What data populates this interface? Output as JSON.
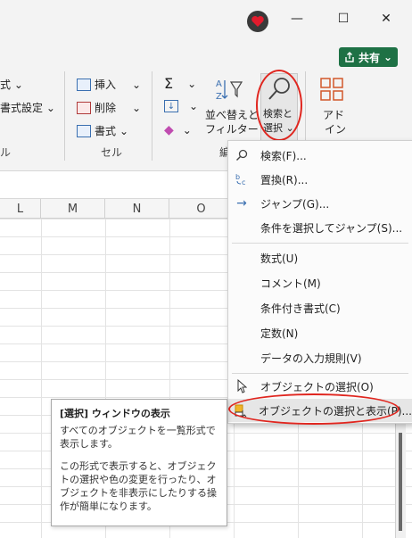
{
  "titlebar": {
    "avatar_icon": "heart-avatar",
    "minimize": "—",
    "maximize": "☐",
    "close": "✕"
  },
  "ribbon": {
    "share": {
      "label": "共有",
      "icon": "share-icon",
      "chevron": "⌄"
    },
    "left_partial": {
      "row1": "式 ⌄",
      "row2": "書式設定 ⌄",
      "group_tail": "ル"
    },
    "cells_group": {
      "insert": "挿入",
      "delete": "削除",
      "format": "書式",
      "label": "セル"
    },
    "editing_group": {
      "sum_icon": "Σ",
      "fill_icon": "↓",
      "clear_icon": "◆",
      "sort_filter": [
        "並べ替えと",
        "フィルター"
      ],
      "find_select": [
        "検索と",
        "選択"
      ],
      "label_partial": "編"
    },
    "addins": {
      "label": [
        "アド",
        "イン"
      ]
    }
  },
  "sheet": {
    "columns": [
      "L",
      "M",
      "N",
      "O"
    ]
  },
  "menu": {
    "items": [
      {
        "label": "検索(F)...",
        "icon": "search-icon",
        "glyph": "⚲"
      },
      {
        "label": "置換(R)...",
        "icon": "replace-icon",
        "glyph": "ᵇc"
      },
      {
        "label": "ジャンプ(G)...",
        "icon": "arrow-right-icon",
        "glyph": "→"
      },
      {
        "label": "条件を選択してジャンプ(S)...",
        "icon": "",
        "glyph": ""
      },
      {
        "label": "数式(U)",
        "icon": "",
        "glyph": ""
      },
      {
        "label": "コメント(M)",
        "icon": "",
        "glyph": ""
      },
      {
        "label": "条件付き書式(C)",
        "icon": "",
        "glyph": ""
      },
      {
        "label": "定数(N)",
        "icon": "",
        "glyph": ""
      },
      {
        "label": "データの入力規則(V)",
        "icon": "",
        "glyph": ""
      },
      {
        "label": "オブジェクトの選択(O)",
        "icon": "cursor-arrow-icon",
        "glyph": "➚"
      },
      {
        "label": "オブジェクトの選択と表示(P)...",
        "icon": "selection-pane-icon",
        "glyph": "▣"
      }
    ]
  },
  "tooltip": {
    "title": "[選択] ウィンドウの表示",
    "body1": "すべてのオブジェクトを一覧形式で表示します。",
    "body2": "この形式で表示すると、オブジェクトの選択や色の変更を行ったり、オブジェクトを非表示にしたりする操作が簡単になります。"
  },
  "colors": {
    "accent_green": "#1e7145",
    "highlight_red": "#e0261f",
    "ribbon_bg": "#f3f3f3"
  }
}
